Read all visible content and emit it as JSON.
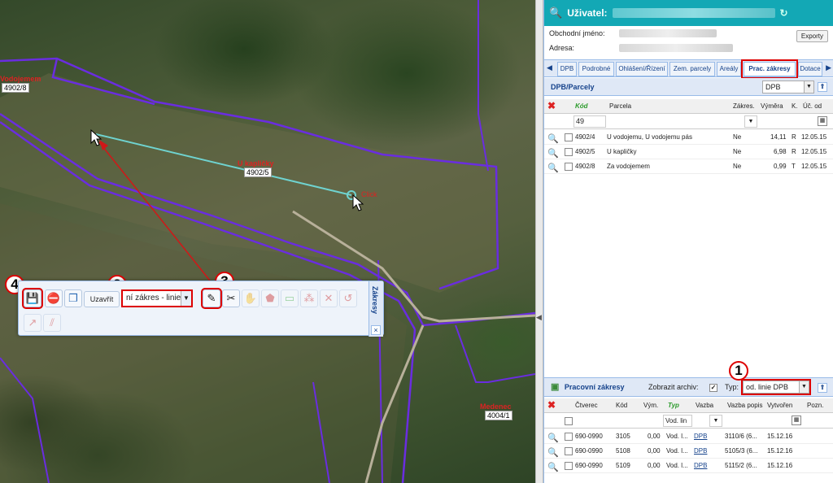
{
  "map": {
    "labels": {
      "vodojemem": "Vodojemem",
      "parcel_4902_8": "4902/8",
      "u_kaplicky": "U kapličky",
      "parcel_4902_5": "4902/5",
      "click": "Click",
      "medenec": "Medenec",
      "parcel_4004_1": "4004/1"
    },
    "markers": [
      "1",
      "2",
      "3",
      "4"
    ]
  },
  "toolbar": {
    "close_label": "Uzavřít",
    "type_value": "ní zákres - linie",
    "side_title": "Zákresy",
    "close_icon": "×"
  },
  "user": {
    "label": "Uživatel:",
    "business_name_label": "Obchodní jméno:",
    "address_label": "Adresa:",
    "export_label": "Exporty"
  },
  "tabs": [
    "DPB",
    "Podrobné",
    "Ohlášení/Řízení",
    "Zem. parcely",
    "Areály",
    "Prac. zákresy",
    "Dotace"
  ],
  "dpb_section": {
    "title": "DPB/Parcely",
    "select_value": "DPB",
    "columns": [
      "Kód",
      "Parcela",
      "Zákres.",
      "Výměra",
      "K.",
      "Úč. od"
    ],
    "filter_value": "49",
    "rows": [
      {
        "code": "4902/4",
        "parcel": "U vodojemu, U vodojemu pás",
        "zakres": "Ne",
        "vymera": "14,11",
        "k": "R",
        "uc_od": "12.05.15"
      },
      {
        "code": "4902/5",
        "parcel": "U kapličky",
        "zakres": "Ne",
        "vymera": "6,98",
        "k": "R",
        "uc_od": "12.05.15"
      },
      {
        "code": "4902/8",
        "parcel": "Za vodojemem",
        "zakres": "Ne",
        "vymera": "0,99",
        "k": "T",
        "uc_od": "12.05.15"
      }
    ]
  },
  "work_section": {
    "title": "Pracovní zákresy",
    "archive_label": "Zobrazit archiv:",
    "type_label": "Typ:",
    "type_value": "od. linie DPB",
    "columns": [
      "Čtverec",
      "Kód",
      "Vým.",
      "Typ",
      "Vazba",
      "Vazba popis",
      "Vytvořen",
      "Pozn."
    ],
    "filter_value": "Vod. lin",
    "rows": [
      {
        "ctverec": "690-0990",
        "kod": "3105",
        "vym": "0,00",
        "typ": "Vod. l...",
        "vazba": "DPB",
        "popis": "3110/6 (6...",
        "vytvoren": "15.12.16"
      },
      {
        "ctverec": "690-0990",
        "kod": "5108",
        "vym": "0,00",
        "typ": "Vod. l...",
        "vazba": "DPB",
        "popis": "5105/3 (6...",
        "vytvoren": "15.12.16"
      },
      {
        "ctverec": "690-0990",
        "kod": "5109",
        "vym": "0,00",
        "typ": "Vod. l...",
        "vazba": "DPB",
        "popis": "5115/2 (6...",
        "vytvoren": "15.12.16"
      }
    ]
  }
}
